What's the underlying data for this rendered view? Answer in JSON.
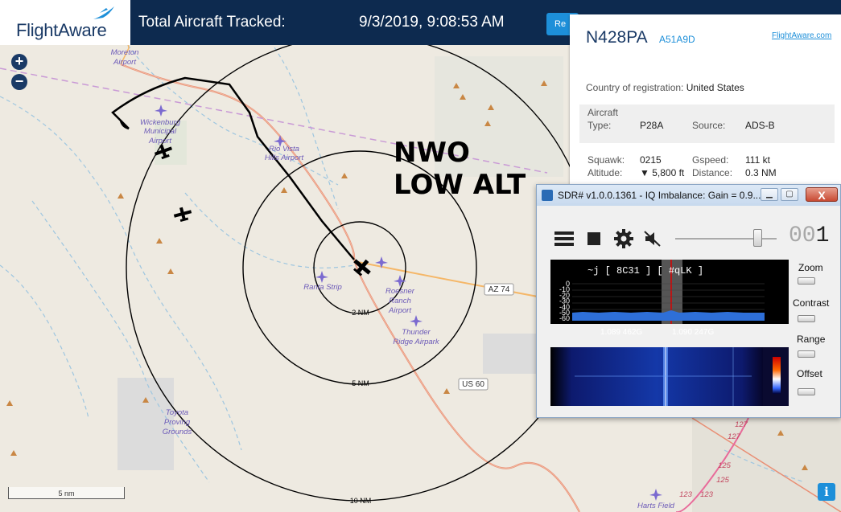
{
  "header": {
    "logo_text": "FlightAware",
    "total_label": "Total Aircraft Tracked:",
    "datetime": "9/3/2019, 9:08:53 AM",
    "reset_label": "Re"
  },
  "map": {
    "zoom_in": "+",
    "zoom_out": "−",
    "scale_label": "5 nm",
    "info_label": "i",
    "overlay_text_1": "NWO",
    "overlay_text_2": "LOW ALT",
    "rings": [
      "2 NM",
      "5 NM",
      "10 NM"
    ],
    "places": [
      {
        "name": "Moreton Airport"
      },
      {
        "name": "Wickenburg Municipal Airport"
      },
      {
        "name": "Rio Vista Hills Airport"
      },
      {
        "name": "Ranta Strip"
      },
      {
        "name": "Roesner Ranch Airport"
      },
      {
        "name": "Thunder Ridge Airpark"
      },
      {
        "name": "Toyota Proving Grounds"
      },
      {
        "name": "Harts Field"
      }
    ],
    "road_labels": [
      "AZ 74",
      "US 60",
      "127",
      "127",
      "125",
      "125",
      "123",
      "123"
    ]
  },
  "aircraft_panel": {
    "registration": "N428PA",
    "hex_code": "A51A9D",
    "link": "FlightAware.com",
    "country_label": "Country of registration:",
    "country_value": "United States",
    "aircraft_type_label": "Aircraft Type:",
    "aircraft_type_label_1": "Aircraft",
    "aircraft_type_label_2": "Type:",
    "aircraft_type_value": "P28A",
    "source_label": "Source:",
    "source_value": "ADS-B",
    "squawk_label": "Squawk:",
    "squawk_value": "0215",
    "gspeed_label": "Gspeed:",
    "gspeed_value": "111 kt",
    "altitude_label": "Altitude:",
    "altitude_value": "▼ 5,800 ft",
    "distance_label": "Distance:",
    "distance_value": "0.3 NM"
  },
  "sdr_window": {
    "title": "SDR# v1.0.0.1361 - IQ Imbalance: Gain = 0.9...",
    "minimize": "▁",
    "maximize": "▢",
    "close": "X",
    "freq_display": "00",
    "freq_display_dark": "1",
    "spectrum_text": "~j      [ 8C31 ]   [ #qLK ]",
    "db_ticks": [
      "0",
      "-10",
      "-20",
      "-30",
      "-40",
      "-50",
      "-60"
    ],
    "freq_labels": [
      "1.089 462G",
      "1.090 247G"
    ],
    "side_controls": [
      "Zoom",
      "Contrast",
      "Range",
      "Offset"
    ],
    "volume_level": 0.85
  },
  "colors": {
    "brand_navy": "#0d2a4f",
    "brand_blue": "#1d8fd9",
    "map_bg": "#eeeae1",
    "road_orange": "#f5b768",
    "route_red": "#e07060"
  }
}
